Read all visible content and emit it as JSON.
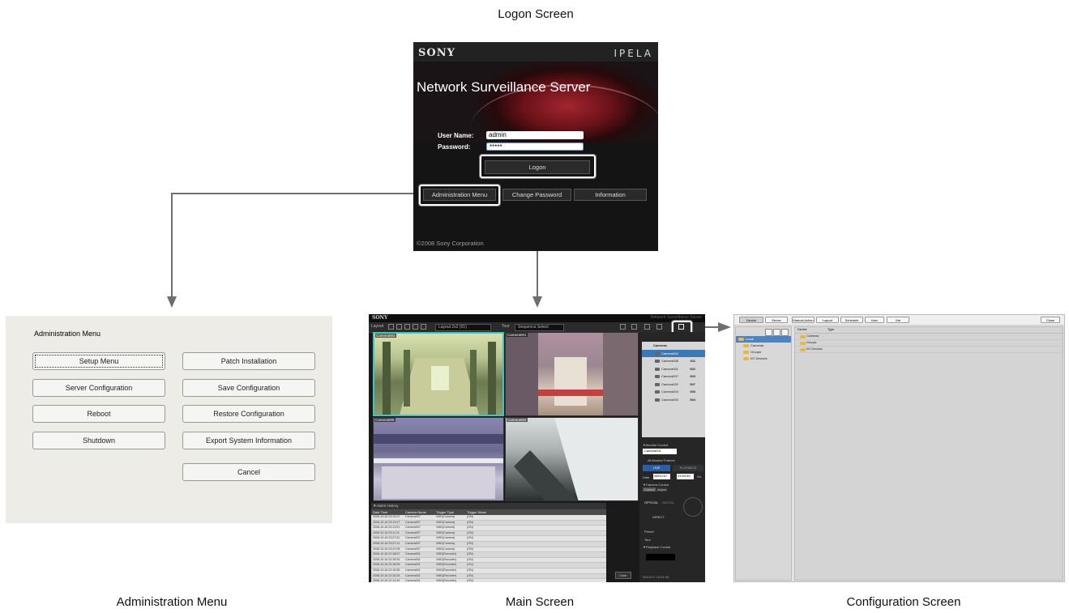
{
  "captions": {
    "logon": "Logon Screen",
    "admin": "Administration Menu",
    "main": "Main Screen",
    "config": "Configuration Screen"
  },
  "logon": {
    "brand": "SONY",
    "brand_right": "IPELA",
    "title": "Network Surveillance Server",
    "user_name_label": "User Name:",
    "user_name_value": "admin",
    "password_label": "Password:",
    "password_value": "*****",
    "logon_button": "Logon",
    "admin_menu_button": "Administration Menu",
    "change_password_button": "Change Password",
    "information_button": "Information",
    "copyright": "©2008 Sony Corporation"
  },
  "admin": {
    "title": "Administration Menu",
    "buttons": {
      "setup_menu": "Setup Menu",
      "patch_installation": "Patch Installation",
      "server_configuration": "Server Configuration",
      "save_configuration": "Save Configuration",
      "reboot": "Reboot",
      "restore_configuration": "Restore Configuration",
      "shutdown": "Shutdown",
      "export_system_information": "Export System Information",
      "cancel": "Cancel"
    }
  },
  "main": {
    "brand": "SONY",
    "header_right": "Network Surveillance Server",
    "toolbar": {
      "layout_label": "Layout",
      "layout_value": "Layout 2x2 (01)",
      "tour_label": "Tour",
      "sequence_value": "Sequence Select"
    },
    "cameras": [
      {
        "label": "Camera004",
        "selected": true
      },
      {
        "label": "Camera001",
        "selected": false
      },
      {
        "label": "Camera005",
        "selected": false
      },
      {
        "label": "Camera002",
        "selected": false
      }
    ],
    "alarm_history": {
      "title": "▼Alarm History",
      "columns": [
        "Date Time",
        "Camera Name",
        "Trigger Type",
        "Trigger Name"
      ],
      "rows": [
        [
          "2008-10-16 23:10:07",
          "Camera007",
          "VMD(Camera)",
          "(ON)"
        ],
        [
          "2008-10-16 23:13:07",
          "Camera007",
          "VMD(Camera)",
          "(ON)"
        ],
        [
          "2008-10-16 23:11:51",
          "Camera007",
          "VMD(Camera)",
          "(ON)"
        ],
        [
          "2008-10-16 23:11:11",
          "Camera007",
          "VMD(Camera)",
          "(ON)"
        ],
        [
          "2008-10-16 23:07:51",
          "Camera007",
          "VMD(Camera)",
          "(ON)"
        ],
        [
          "2008-10-16 23:07:11",
          "Camera007",
          "VMD(Camera)",
          "(ON)"
        ],
        [
          "2008-10-16 23:07:08",
          "Camera007",
          "VMD(Camera)",
          "(ON)"
        ],
        [
          "2008-10-16 22:18:57",
          "Camera001",
          "VMD(Recorder)",
          "(ON)"
        ],
        [
          "2008-10-16 22:18:34",
          "Camera001",
          "VMD(Recorder)",
          "(ON)"
        ],
        [
          "2008-10-16 22:18:09",
          "Camera001",
          "VMD(Recorder)",
          "(ON)"
        ],
        [
          "2008-10-16 22:16:55",
          "Camera001",
          "VMD(Recorder)",
          "(ON)"
        ],
        [
          "2008-10-16 22:15:26",
          "Camera001",
          "VMD(Recorder)",
          "(ON)"
        ],
        [
          "2008-10-16 22:14:40",
          "Camera001",
          "VMD(Recorder)",
          "(ON)"
        ]
      ],
      "clear_button": "Clear"
    },
    "tree": {
      "root": "Cameras",
      "items": [
        {
          "name": "Camera004",
          "id": "",
          "selected": true
        },
        {
          "name": "Camera008",
          "id": "011",
          "selected": false
        },
        {
          "name": "Camera001",
          "id": "002",
          "selected": false
        },
        {
          "name": "Camera007",
          "id": "003",
          "selected": false
        },
        {
          "name": "Camera002",
          "id": "007",
          "selected": false
        },
        {
          "name": "Camera004",
          "id": "006",
          "selected": false
        },
        {
          "name": "Camera003",
          "id": "004",
          "selected": false
        }
      ]
    },
    "monitor_control": {
      "title": "▼Monitor Control",
      "camera_value": "Camera001",
      "all_monitor_frames": "All Monitor Frames",
      "live": "LIVE",
      "playback": "PLAYBACK",
      "date_label": "Date",
      "date_value": "08/01/10",
      "time_value": "23:59:59",
      "go_button": "Go"
    },
    "camera_control": {
      "title": "▼Camera Control",
      "tabs": [
        "Control",
        "Adjust"
      ],
      "optical": "OPTICAL",
      "digital": "DIGITAL",
      "direct": "DIRECT",
      "preset": "Preset",
      "tour": "Tour"
    },
    "playback_control": {
      "title": "▼Playback Control"
    },
    "status_time": "09/10/17 16:51:35"
  },
  "config": {
    "tabs": [
      "Device",
      "Server",
      "Manual Action",
      "Layout",
      "Schedule",
      "User",
      "Get"
    ],
    "close_button": "Close",
    "tree": [
      "Local",
      "Cameras",
      "Groups",
      "I/O Devices"
    ],
    "columns": [
      "Device",
      "Type"
    ],
    "rows": [
      "Cameras",
      "Groups",
      "I/O Devices"
    ]
  },
  "colors": {
    "highlight": "#ffffff",
    "arrow": "#6e6e6e",
    "selected": "#3c78b4",
    "live": "#2a5fa8"
  }
}
